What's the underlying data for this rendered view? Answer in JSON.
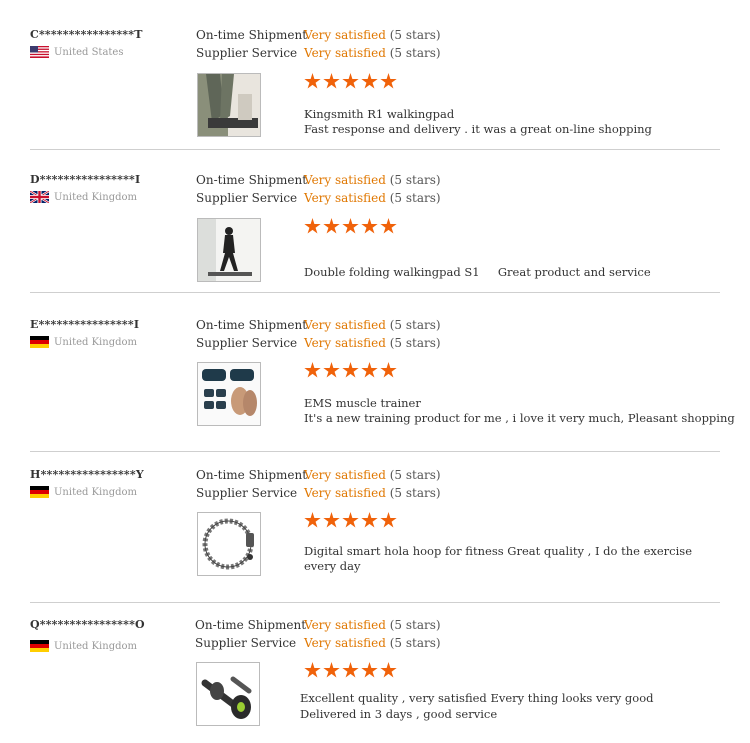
{
  "labels": {
    "on_time": "On-time Shipment",
    "supplier": "Supplier Service",
    "satisfied": "Very satisfied",
    "stars_count": "(5 stars)"
  },
  "colors": {
    "accent": "#e07700",
    "star": "#f0620a",
    "divider": "#cfcfcf"
  },
  "reviews": [
    {
      "buyer": "C****************T",
      "country": "United States",
      "flag": "us-flag",
      "rating": 5,
      "line1": "Kingsmith R1 walkingpad",
      "line2": "Fast response and delivery . it was a great on-line shopping",
      "thumb": "walkingpad-legs-photo"
    },
    {
      "buyer": "D****************I",
      "country": "United Kingdom",
      "flag": "uk-flag",
      "rating": 5,
      "line1": "Double folding walkingpad S1     Great product and service",
      "line2": "",
      "thumb": "man-walking-photo"
    },
    {
      "buyer": "E****************I",
      "country": "United Kingdom",
      "flag": "de-flag",
      "rating": 5,
      "line1": "EMS muscle trainer",
      "line2": "It's a new training product for me , i love it very much, Pleasant shopping",
      "thumb": "ems-trainer-photo"
    },
    {
      "buyer": "H****************Y",
      "country": "United Kingdom",
      "flag": "de-flag",
      "rating": 5,
      "line1": "Digital smart hola hoop for fitness   Great quality , I do the exercise every day",
      "line2": "",
      "thumb": "hula-hoop-photo"
    },
    {
      "buyer": "Q****************O",
      "country": "United Kingdom",
      "flag": "de-flag",
      "rating": 5,
      "line1": "Excellent quality , very satisfied  Every thing looks very good",
      "line2": "Delivered in 3 days , good service",
      "thumb": "ab-roller-photo"
    }
  ]
}
